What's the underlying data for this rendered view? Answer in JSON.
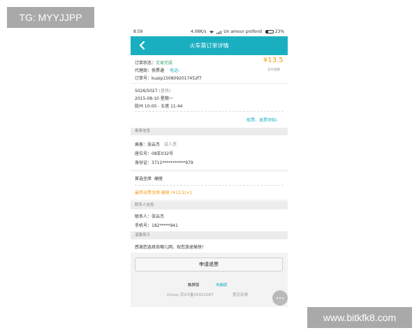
{
  "watermarks": {
    "top_left": "TG: MYYJJPP",
    "bottom_right": "www.bitkfk8.com"
  },
  "status_bar": {
    "time": "8:59",
    "speed": "4.08K/s",
    "carrier": "Un amour profond",
    "battery": "23%"
  },
  "header": {
    "title": "火车票订单详情",
    "back_icon": "chevron-left-icon"
  },
  "order": {
    "status_label": "订单状态：",
    "status_value": "交易完成",
    "agent_label": "代理商：",
    "agent_value": "快票通",
    "phone_link": "电话›",
    "order_no_label": "订单号：",
    "order_no_value": "kuaip1508092017452f7",
    "price": "¥13.5",
    "price_note": "支付金额"
  },
  "trip": {
    "train": "5026/5027",
    "train_note": "(普快)",
    "date": "2015-08-10 星期一",
    "route": "胶州 10:00 - 五莲 11:44",
    "refund_notice": "取票、退票须知›"
  },
  "passenger": {
    "section_title": "乘客信息",
    "name_label": "乘客：",
    "name_value": "张云杰",
    "ticket_type": "成人票",
    "seat_label": "座位号：",
    "seat_value": "08车032号",
    "id_label": "身份证：",
    "id_value": "3711***********979",
    "preferred_seat_label": "首选坐席",
    "preferred_seat_value": "硬座",
    "final_seat": "最终出票坐席 硬座 (¥13.5)×1"
  },
  "contact": {
    "section_title": "联系人信息",
    "name_label": "联系人：",
    "name_value": "张云杰",
    "phone_label": "手机号：",
    "phone_value": "182*****941"
  },
  "tips": {
    "section_title": "温馨提示",
    "text": "感谢您选择去哪儿网，祝您旅途愉快！"
  },
  "actions": {
    "refund_button": "申请退票"
  },
  "footer": {
    "touch_version": "触屏版",
    "pc_version": "电脑版",
    "icp": "Qunar 京ICP备05021087",
    "feedback": "意见反馈"
  },
  "colors": {
    "brand": "#1aafc0",
    "price": "#f39c12",
    "status": "#3aa56a"
  }
}
